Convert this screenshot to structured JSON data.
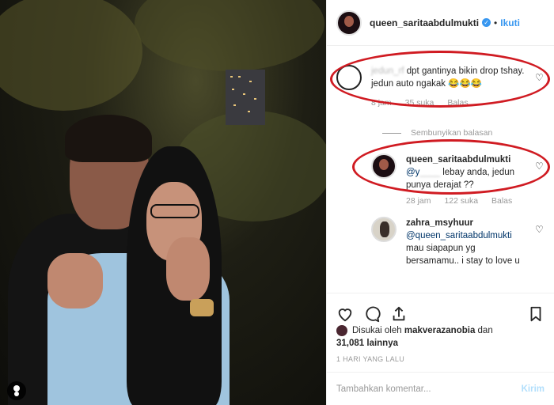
{
  "post": {
    "username": "queen_saritaabdulmukti",
    "separator": "•",
    "follow_label": "Ikuti"
  },
  "comments": [
    {
      "user": "",
      "hidden_text": "jedun_rf",
      "text": " dpt gantinya bikin drop tshay. jedun auto ngakak",
      "emoji": "😂😂😂",
      "time": "8 jam",
      "likes": "35 suka",
      "reply": "Balas"
    }
  ],
  "replies_toggle": "Sembunyikan balasan",
  "replies": [
    {
      "user": "queen_saritaabdulmukti",
      "mention": "@y",
      "hidden_text": "____",
      "text": " lebay anda, jedun punya derajat ??",
      "time": "28 jam",
      "likes": "122 suka",
      "reply": "Balas"
    },
    {
      "user": "zahra_msyhuur",
      "mention": "@queen_saritaabdulmukti",
      "text": " mau siapapun yg bersamamu.. i stay to love u"
    }
  ],
  "likes": {
    "liked_by_prefix": "Disukai oleh ",
    "liked_by_user": "makverazanobia",
    "liked_by_suffix": " dan ",
    "others": "31,081 lainnya"
  },
  "timestamp": "1 HARI YANG LALU",
  "add_comment": {
    "placeholder": "Tambahkan komentar...",
    "post_label": "Kirim"
  },
  "icons": {
    "verified": "verified-badge-icon",
    "like": "heart-icon",
    "comment": "comment-icon",
    "share": "share-icon",
    "save": "bookmark-icon"
  },
  "colors": {
    "accent": "#3897f0",
    "annotation": "#d01b22"
  }
}
